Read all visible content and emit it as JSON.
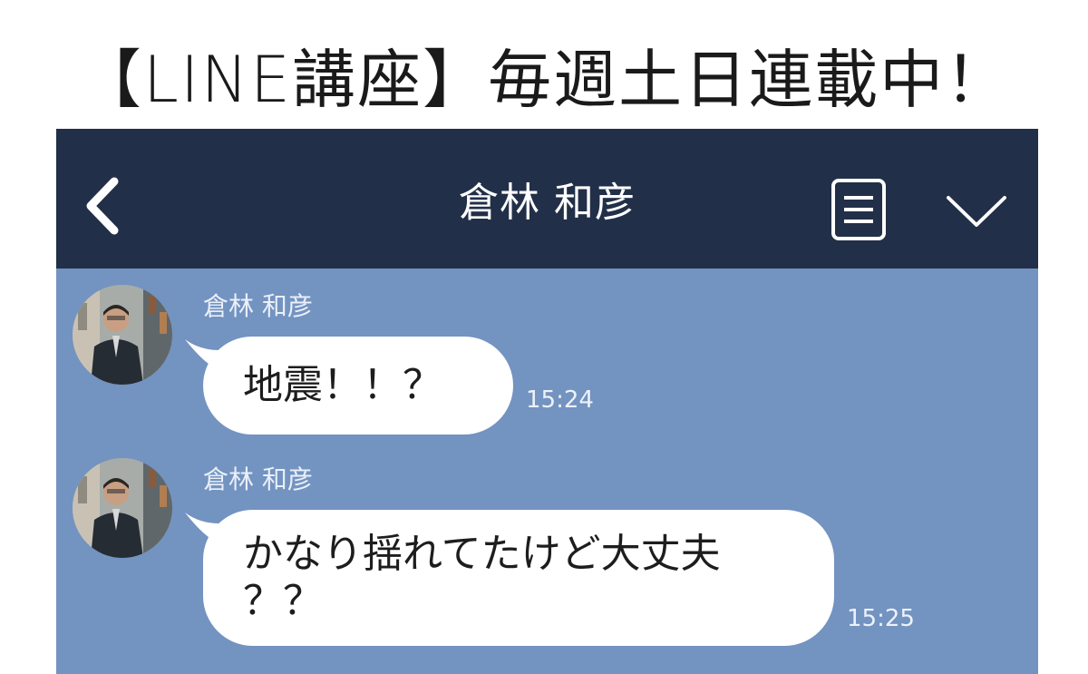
{
  "banner": {
    "text": "【LINE講座】毎週土日連載中！"
  },
  "header": {
    "title": "倉林 和彦",
    "back_icon": "chevron-left-icon",
    "menu_icon": "list-menu-icon",
    "expand_icon": "chevron-down-icon"
  },
  "colors": {
    "header_bg": "#222f48",
    "chat_bg": "#7393c1",
    "bubble_bg": "#ffffff"
  },
  "messages": [
    {
      "sender": "倉林 和彦",
      "text": "地震！！？",
      "time": "15:24"
    },
    {
      "sender": "倉林 和彦",
      "text_line1": "かなり揺れてたけど大丈夫",
      "text_line2": "？？",
      "time": "15:25"
    }
  ]
}
